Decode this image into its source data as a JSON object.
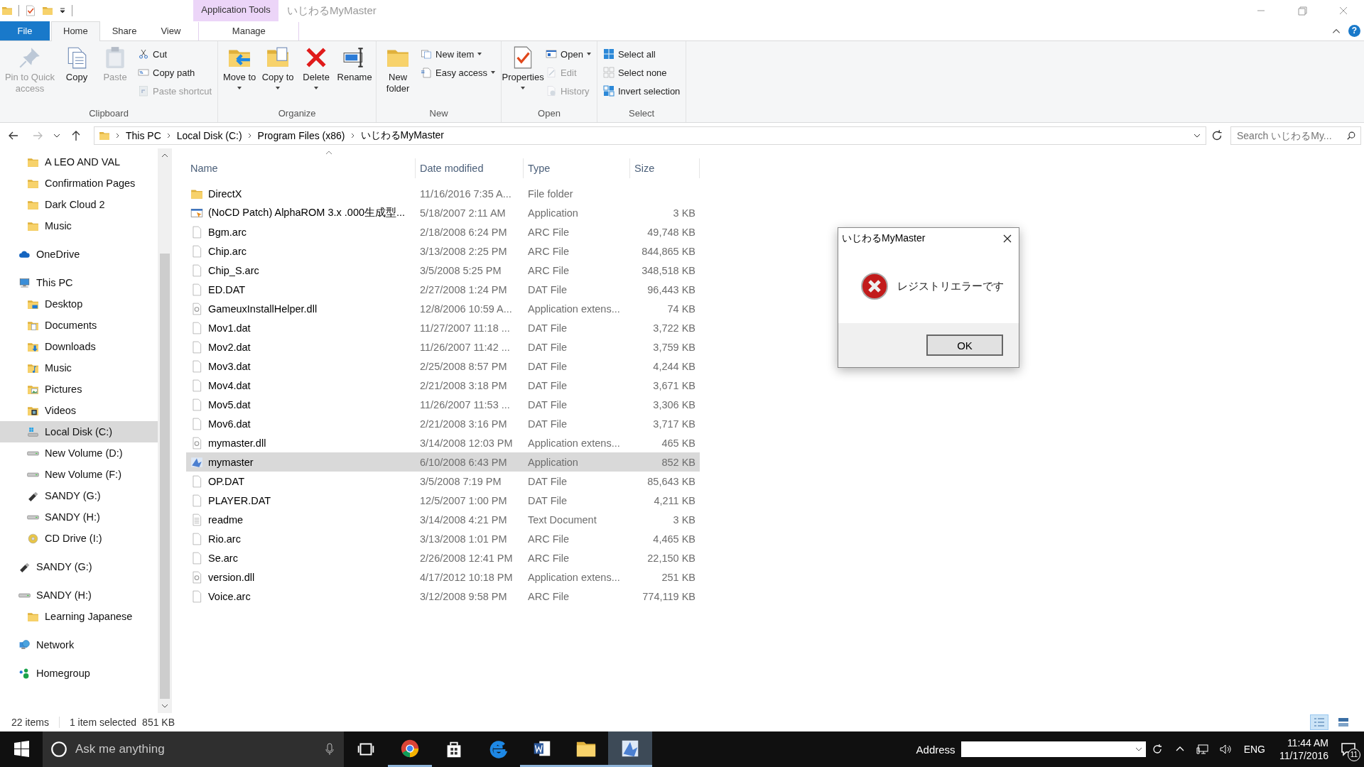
{
  "title_bar": {
    "context_tab": "Application Tools",
    "title": "いじわるMyMaster",
    "help": "?"
  },
  "ribbon_tabs": [
    {
      "label": "File",
      "kind": "file",
      "selected": false
    },
    {
      "label": "Home",
      "kind": "tab",
      "selected": true
    },
    {
      "label": "Share",
      "kind": "tab",
      "selected": false
    },
    {
      "label": "View",
      "kind": "tab",
      "selected": false
    },
    {
      "label": "Manage",
      "kind": "context",
      "selected": false
    }
  ],
  "ribbon_groups": [
    {
      "label": "Clipboard",
      "items": [
        {
          "label": "Pin to Quick access",
          "kind": "large",
          "disabled": true,
          "dropdown": false
        },
        {
          "label": "Copy",
          "kind": "large",
          "disabled": false,
          "dropdown": false
        },
        {
          "label": "Paste",
          "kind": "large",
          "disabled": true,
          "dropdown": false
        },
        {
          "label": "Cut",
          "kind": "small",
          "disabled": false,
          "dropdown": false
        },
        {
          "label": "Copy path",
          "kind": "small",
          "disabled": false,
          "dropdown": false
        },
        {
          "label": "Paste shortcut",
          "kind": "small",
          "disabled": true,
          "dropdown": false
        }
      ]
    },
    {
      "label": "Organize",
      "items": [
        {
          "label": "Move to",
          "kind": "large",
          "disabled": false,
          "dropdown": true
        },
        {
          "label": "Copy to",
          "kind": "large",
          "disabled": false,
          "dropdown": true
        },
        {
          "label": "Delete",
          "kind": "large",
          "disabled": false,
          "dropdown": true
        },
        {
          "label": "Rename",
          "kind": "large",
          "disabled": false,
          "dropdown": false
        }
      ]
    },
    {
      "label": "New",
      "items": [
        {
          "label": "New folder",
          "kind": "large",
          "disabled": false,
          "dropdown": false
        },
        {
          "label": "New item",
          "kind": "small",
          "disabled": false,
          "dropdown": true
        },
        {
          "label": "Easy access",
          "kind": "small",
          "disabled": false,
          "dropdown": true
        }
      ]
    },
    {
      "label": "Open",
      "items": [
        {
          "label": "Properties",
          "kind": "large",
          "disabled": false,
          "dropdown": true
        },
        {
          "label": "Open",
          "kind": "small",
          "disabled": false,
          "dropdown": true
        },
        {
          "label": "Edit",
          "kind": "small",
          "disabled": true,
          "dropdown": false
        },
        {
          "label": "History",
          "kind": "small",
          "disabled": true,
          "dropdown": false
        }
      ]
    },
    {
      "label": "Select",
      "items": [
        {
          "label": "Select all",
          "kind": "small",
          "disabled": false,
          "dropdown": false
        },
        {
          "label": "Select none",
          "kind": "small",
          "disabled": false,
          "dropdown": false
        },
        {
          "label": "Invert selection",
          "kind": "small",
          "disabled": false,
          "dropdown": false
        }
      ]
    }
  ],
  "navigation": {
    "back_disabled": false,
    "forward_disabled": true
  },
  "breadcrumb": [
    "This PC",
    "Local Disk (C:)",
    "Program Files (x86)",
    "いじわるMyMaster"
  ],
  "search": {
    "placeholder": "Search いじわるMy..."
  },
  "sidebar": {
    "items": [
      {
        "children": [
          {
            "label": "A LEO AND VAL",
            "kind": "folder",
            "selected": false
          },
          {
            "label": "Confirmation Pages",
            "kind": "folder",
            "selected": false
          },
          {
            "label": "Dark Cloud 2",
            "kind": "folder",
            "selected": false
          },
          {
            "label": "Music",
            "kind": "folder",
            "selected": false
          }
        ]
      },
      {
        "label": "OneDrive",
        "kind": "cloud",
        "selected": false
      },
      {
        "label": "This PC",
        "kind": "computer",
        "selected": false,
        "children": [
          {
            "label": "Desktop",
            "kind": "desktop",
            "selected": false
          },
          {
            "label": "Documents",
            "kind": "documents",
            "selected": false
          },
          {
            "label": "Downloads",
            "kind": "downloads",
            "selected": false
          },
          {
            "label": "Music",
            "kind": "music",
            "selected": false
          },
          {
            "label": "Pictures",
            "kind": "pictures",
            "selected": false
          },
          {
            "label": "Videos",
            "kind": "videos",
            "selected": false
          },
          {
            "label": "Local Disk (C:)",
            "kind": "windrive",
            "selected": true
          },
          {
            "label": "New Volume (D:)",
            "kind": "drive",
            "selected": false
          },
          {
            "label": "New Volume (F:)",
            "kind": "drive",
            "selected": false
          },
          {
            "label": "SANDY (G:)",
            "kind": "usb",
            "selected": false
          },
          {
            "label": "SANDY (H:)",
            "kind": "drive",
            "selected": false
          },
          {
            "label": "CD Drive (I:)",
            "kind": "disc",
            "selected": false
          }
        ]
      },
      {
        "label": "SANDY (G:)",
        "kind": "usb",
        "selected": false
      },
      {
        "label": "SANDY (H:)",
        "kind": "drive",
        "selected": false,
        "children": [
          {
            "label": "Learning Japanese",
            "kind": "folder",
            "selected": false
          }
        ]
      },
      {
        "label": "Network",
        "kind": "network",
        "selected": false
      },
      {
        "label": "Homegroup",
        "kind": "homegroup",
        "selected": false
      }
    ]
  },
  "table": {
    "columns": [
      "Name",
      "Date modified",
      "Type",
      "Size"
    ],
    "rows": [
      {
        "name": "DirectX",
        "date": "11/16/2016 7:35 A...",
        "type": "File folder",
        "size": "",
        "kind": "folder",
        "selected": false
      },
      {
        "name": "(NoCD Patch) AlphaROM 3.x .000生成型...",
        "date": "5/18/2007 2:11 AM",
        "type": "Application",
        "size": "3 KB",
        "kind": "app",
        "selected": false
      },
      {
        "name": "Bgm.arc",
        "date": "2/18/2008 6:24 PM",
        "type": "ARC File",
        "size": "49,748 KB",
        "kind": "file",
        "selected": false
      },
      {
        "name": "Chip.arc",
        "date": "3/13/2008 2:25 PM",
        "type": "ARC File",
        "size": "844,865 KB",
        "kind": "file",
        "selected": false
      },
      {
        "name": "Chip_S.arc",
        "date": "3/5/2008 5:25 PM",
        "type": "ARC File",
        "size": "348,518 KB",
        "kind": "file",
        "selected": false
      },
      {
        "name": "ED.DAT",
        "date": "2/27/2008 1:24 PM",
        "type": "DAT File",
        "size": "96,443 KB",
        "kind": "file",
        "selected": false
      },
      {
        "name": "GameuxInstallHelper.dll",
        "date": "12/8/2006 10:59 A...",
        "type": "Application extens...",
        "size": "74 KB",
        "kind": "dll",
        "selected": false
      },
      {
        "name": "Mov1.dat",
        "date": "11/27/2007 11:18 ...",
        "type": "DAT File",
        "size": "3,722 KB",
        "kind": "file",
        "selected": false
      },
      {
        "name": "Mov2.dat",
        "date": "11/26/2007 11:42 ...",
        "type": "DAT File",
        "size": "3,759 KB",
        "kind": "file",
        "selected": false
      },
      {
        "name": "Mov3.dat",
        "date": "2/25/2008 8:57 PM",
        "type": "DAT File",
        "size": "4,244 KB",
        "kind": "file",
        "selected": false
      },
      {
        "name": "Mov4.dat",
        "date": "2/21/2008 3:18 PM",
        "type": "DAT File",
        "size": "3,671 KB",
        "kind": "file",
        "selected": false
      },
      {
        "name": "Mov5.dat",
        "date": "11/26/2007 11:53 ...",
        "type": "DAT File",
        "size": "3,306 KB",
        "kind": "file",
        "selected": false
      },
      {
        "name": "Mov6.dat",
        "date": "2/21/2008 3:16 PM",
        "type": "DAT File",
        "size": "3,717 KB",
        "kind": "file",
        "selected": false
      },
      {
        "name": "mymaster.dll",
        "date": "3/14/2008 12:03 PM",
        "type": "Application extens...",
        "size": "465 KB",
        "kind": "dll",
        "selected": false
      },
      {
        "name": "mymaster",
        "date": "6/10/2008 6:43 PM",
        "type": "Application",
        "size": "852 KB",
        "kind": "game",
        "selected": true
      },
      {
        "name": "OP.DAT",
        "date": "3/5/2008 7:19 PM",
        "type": "DAT File",
        "size": "85,643 KB",
        "kind": "file",
        "selected": false
      },
      {
        "name": "PLAYER.DAT",
        "date": "12/5/2007 1:00 PM",
        "type": "DAT File",
        "size": "4,211 KB",
        "kind": "file",
        "selected": false
      },
      {
        "name": "readme",
        "date": "3/14/2008 4:21 PM",
        "type": "Text Document",
        "size": "3 KB",
        "kind": "text",
        "selected": false
      },
      {
        "name": "Rio.arc",
        "date": "3/13/2008 1:01 PM",
        "type": "ARC File",
        "size": "4,465 KB",
        "kind": "file",
        "selected": false
      },
      {
        "name": "Se.arc",
        "date": "2/26/2008 12:41 PM",
        "type": "ARC File",
        "size": "22,150 KB",
        "kind": "file",
        "selected": false
      },
      {
        "name": "version.dll",
        "date": "4/17/2012 10:18 PM",
        "type": "Application extens...",
        "size": "251 KB",
        "kind": "dll",
        "selected": false
      },
      {
        "name": "Voice.arc",
        "date": "3/12/2008 9:58 PM",
        "type": "ARC File",
        "size": "774,119 KB",
        "kind": "file",
        "selected": false
      }
    ]
  },
  "status_bar": {
    "count": "22 items",
    "selection": "1 item selected",
    "size": "851 KB",
    "views": [
      {
        "selected": true
      },
      {
        "selected": false
      }
    ]
  },
  "dialog": {
    "title": "いじわるMyMaster",
    "message": "レジストリエラーです",
    "button": "OK"
  },
  "taskbar": {
    "search_placeholder": "Ask me anything",
    "apps": [
      {
        "kind": "taskview",
        "running": false,
        "active": false
      },
      {
        "kind": "chrome",
        "running": true,
        "active": false
      },
      {
        "kind": "store",
        "running": false,
        "active": false
      },
      {
        "kind": "edge",
        "running": false,
        "active": false
      },
      {
        "kind": "word",
        "running": true,
        "active": false
      },
      {
        "kind": "explorer",
        "running": true,
        "active": false
      },
      {
        "kind": "game",
        "running": true,
        "active": true
      }
    ],
    "address_label": "Address",
    "language": "ENG",
    "time": "11:44 AM",
    "date": "11/17/2016",
    "notifications": "11"
  }
}
